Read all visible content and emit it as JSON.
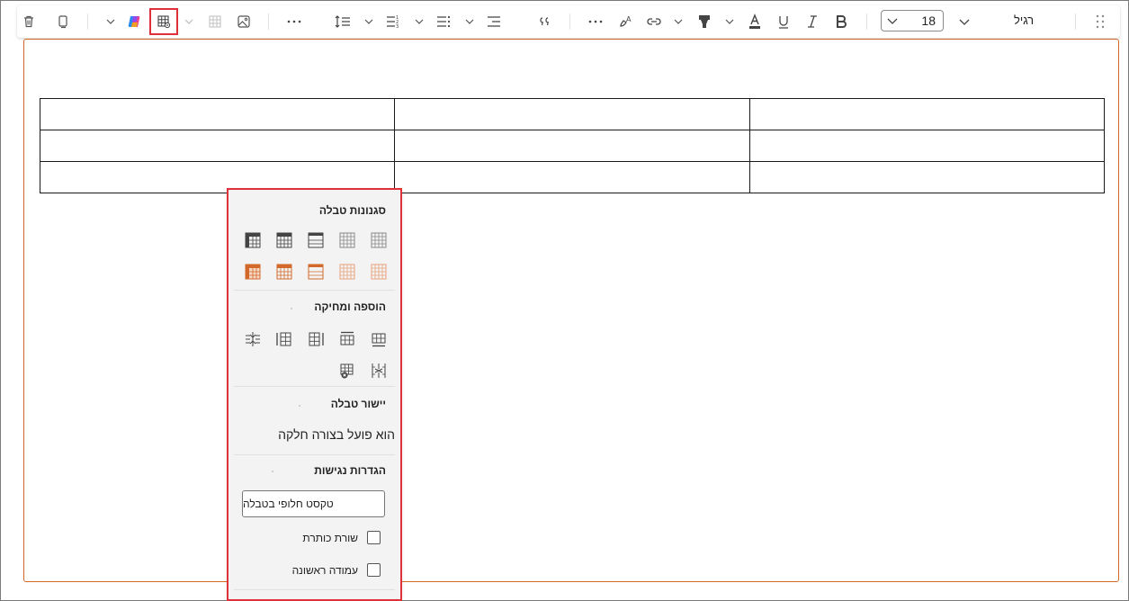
{
  "toolbar": {
    "style_label": "רגיל",
    "font_size": "18",
    "icons": [
      "drag-handle-icon",
      "font-style-chevron-icon",
      "bold-icon",
      "italic-icon",
      "underline-icon",
      "font-color-icon",
      "highlight-icon",
      "link-icon",
      "format-painter-icon",
      "more-icon",
      "quote-icon",
      "align-icon",
      "bullets-icon",
      "numbering-icon",
      "line-spacing-icon",
      "more-icon",
      "image-icon",
      "table-disabled-icon",
      "table-settings-icon",
      "copilot-icon",
      "copy-icon",
      "delete-icon"
    ]
  },
  "panel": {
    "table_styles_title": "סגנונות טבלה",
    "insert_delete_title": "הוספה ומחיקה",
    "alignment_title": "יישור טבלה",
    "alignment_value": "הוא פועל בצורה חלקה",
    "accessibility_title": "הגדרות נגישות",
    "alt_text_value": "טקסט חלופי בטבלה",
    "header_row_label": "שורת כותרת",
    "first_column_label": "עמודה ראשונה",
    "colors": {
      "dark": "#444444",
      "orange": "#d2692a",
      "highlight": "#e0313b"
    }
  }
}
